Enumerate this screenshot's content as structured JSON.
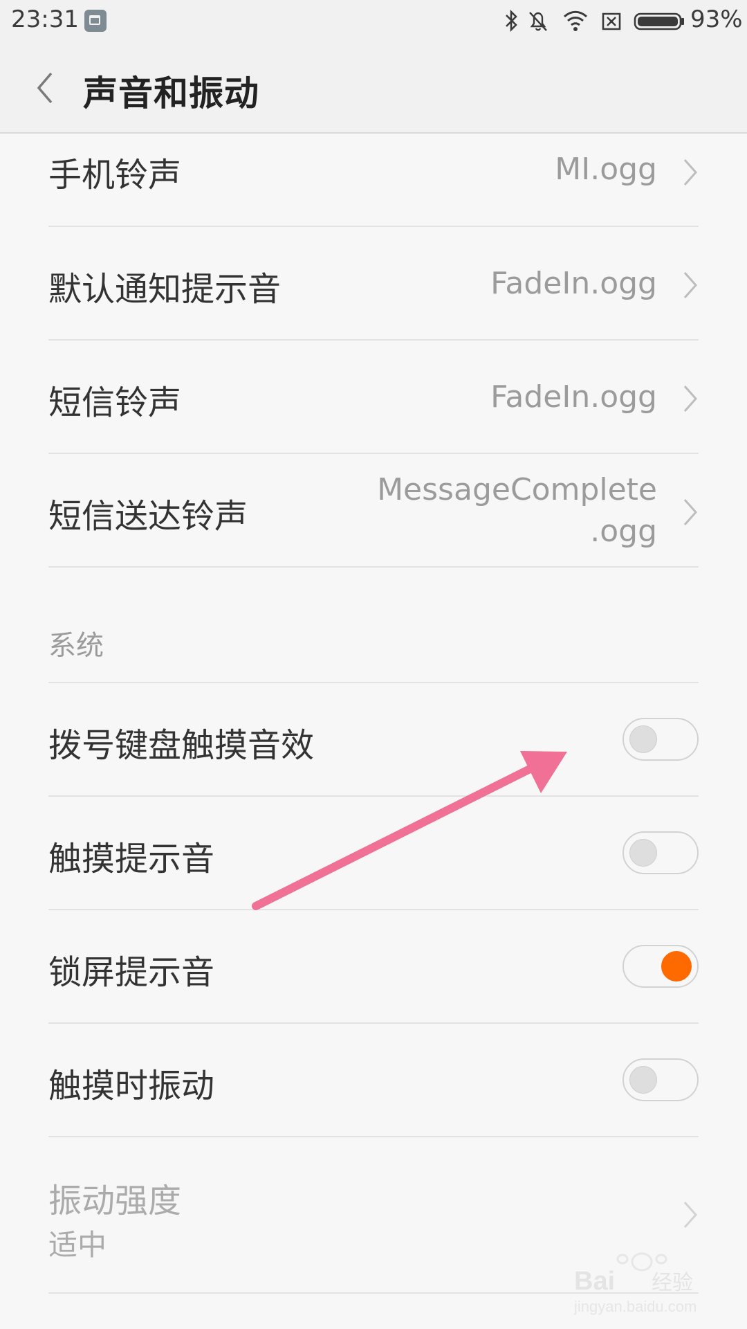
{
  "status_bar": {
    "time": "23:31",
    "battery_percent": "93%",
    "icons": [
      "notification-icon",
      "bluetooth-icon",
      "silent-bell-icon",
      "wifi-icon",
      "sim-x-icon",
      "battery-icon"
    ]
  },
  "header": {
    "title": "声音和振动",
    "back_icon": "chevron-left-icon"
  },
  "ringtones": [
    {
      "label": "手机铃声",
      "value": "MI.ogg"
    },
    {
      "label": "默认通知提示音",
      "value": "FadeIn.ogg"
    },
    {
      "label": "短信铃声",
      "value": "FadeIn.ogg"
    },
    {
      "label": "短信送达铃声",
      "value_line1": "MessageComplete",
      "value_line2": ".ogg"
    }
  ],
  "system": {
    "section_title": "系统",
    "toggles": [
      {
        "label": "拨号键盘触摸音效",
        "on": false
      },
      {
        "label": "触摸提示音",
        "on": false
      },
      {
        "label": "锁屏提示音",
        "on": true
      },
      {
        "label": "触摸时振动",
        "on": false
      }
    ],
    "vibration": {
      "label": "振动强度",
      "value": "适中",
      "enabled": false
    }
  },
  "annotation": {
    "arrow_color": "#f07096"
  },
  "colors": {
    "accent": "#ff6a00"
  },
  "watermark": {
    "text": "Baidu经验",
    "url_text": "jingyan.baidu.com"
  }
}
